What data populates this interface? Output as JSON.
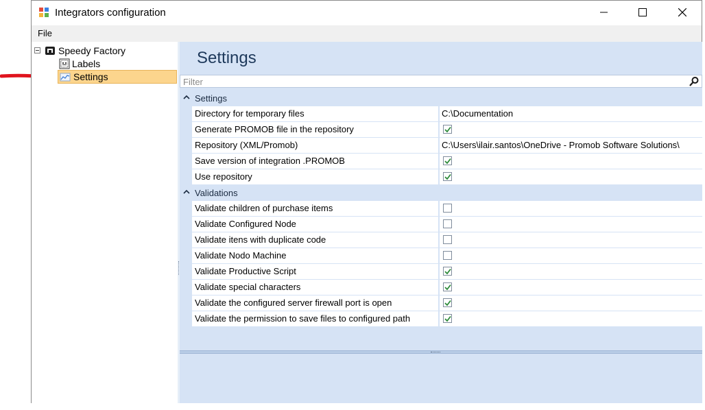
{
  "window": {
    "title": "Integrators configuration",
    "controls": {
      "minimize": "minimize-icon",
      "maximize": "maximize-icon",
      "close": "close-icon"
    }
  },
  "menu": {
    "file": "File"
  },
  "tree": {
    "root": {
      "label": "Speedy Factory",
      "expanded": true,
      "icon": "factory-icon"
    },
    "children": [
      {
        "label": "Labels",
        "icon": "labels-icon",
        "selected": false
      },
      {
        "label": "Settings",
        "icon": "settings-chart-icon",
        "selected": true
      }
    ]
  },
  "main": {
    "heading": "Settings",
    "filter_placeholder": "Filter",
    "categories": [
      {
        "label": "Settings",
        "rows": [
          {
            "name": "Directory for temporary files",
            "type": "text",
            "value": "C:\\Documentation"
          },
          {
            "name": "Generate PROMOB file in the repository",
            "type": "check",
            "checked": true
          },
          {
            "name": "Repository (XML/Promob)",
            "type": "text",
            "value": "C:\\Users\\ilair.santos\\OneDrive - Promob Software Solutions\\"
          },
          {
            "name": "Save version of integration .PROMOB",
            "type": "check",
            "checked": true
          },
          {
            "name": "Use repository",
            "type": "check",
            "checked": true
          }
        ]
      },
      {
        "label": "Validations",
        "rows": [
          {
            "name": "Validate children of purchase items",
            "type": "check",
            "checked": false
          },
          {
            "name": "Validate Configured Node",
            "type": "check",
            "checked": false
          },
          {
            "name": "Validate itens with duplicate code",
            "type": "check",
            "checked": false
          },
          {
            "name": "Validate Nodo Machine",
            "type": "check",
            "checked": false
          },
          {
            "name": "Validate Productive Script",
            "type": "check",
            "checked": true
          },
          {
            "name": "Validate special characters",
            "type": "check",
            "checked": true
          },
          {
            "name": "Validate the configured server firewall port is open",
            "type": "check",
            "checked": true
          },
          {
            "name": "Validate the permission to save files to configured path",
            "type": "check",
            "checked": true
          }
        ]
      }
    ]
  },
  "colors": {
    "selection": "#fcd58d",
    "panel": "#d6e3f5",
    "heading": "#1e395b",
    "annotation_arrow": "#e0141e",
    "check": "#2e8b3a"
  }
}
